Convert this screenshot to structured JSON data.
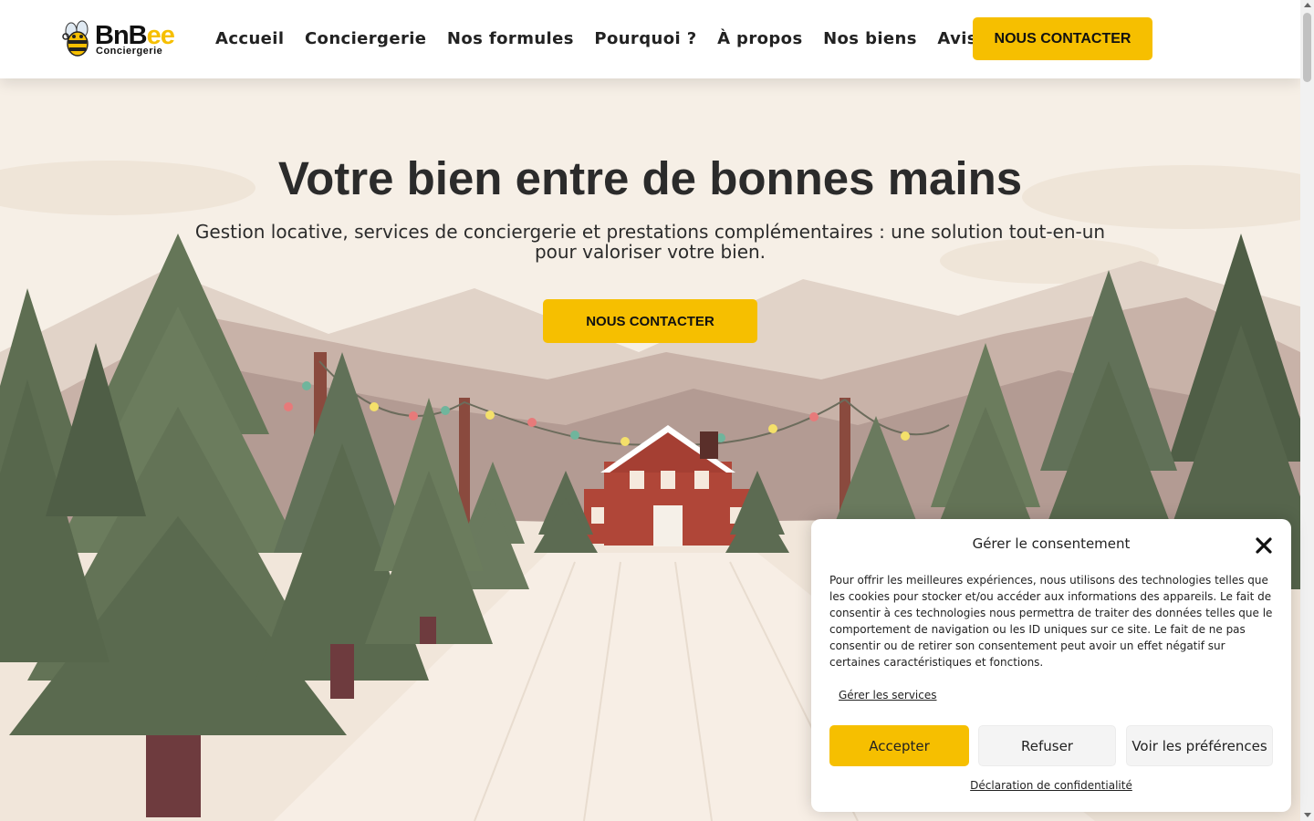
{
  "header": {
    "logo": {
      "word_part1": "BnB",
      "word_accent": "ee",
      "tagline": "Conciergerie",
      "icon": "bee-icon"
    },
    "nav": [
      {
        "label": "Accueil"
      },
      {
        "label": "Conciergerie"
      },
      {
        "label": "Nos formules"
      },
      {
        "label": "Pourquoi ?"
      },
      {
        "label": "À propos"
      },
      {
        "label": "Nos biens"
      },
      {
        "label": "Avis"
      }
    ],
    "cta_label": "NOUS CONTACTER"
  },
  "hero": {
    "title": "Votre bien entre de bonnes mains",
    "subtitle": "Gestion locative, services de conciergerie et prestations complémentaires : une solution tout-en-un pour valoriser votre bien.",
    "cta_label": "NOUS CONTACTER",
    "background": "winter-landscape-illustration"
  },
  "consent": {
    "title": "Gérer le consentement",
    "close_icon": "close-icon",
    "text": "Pour offrir les meilleures expériences, nous utilisons des technologies telles que les cookies pour stocker et/ou accéder aux informations des appareils. Le fait de consentir à ces technologies nous permettra de traiter des données telles que le comportement de navigation ou les ID uniques sur ce site. Le fait de ne pas consentir ou de retirer son consentement peut avoir un effet négatif sur certaines caractéristiques et fonctions.",
    "manage_services": "Gérer les services",
    "accept": "Accepter",
    "refuse": "Refuser",
    "preferences": "Voir les préférences",
    "policy": "Déclaration de confidentialité"
  },
  "colors": {
    "accent": "#f6bf00",
    "text": "#2b2b2b",
    "sky": "#f6efe6",
    "tree": "#5f6f55",
    "house": "#b04638"
  }
}
